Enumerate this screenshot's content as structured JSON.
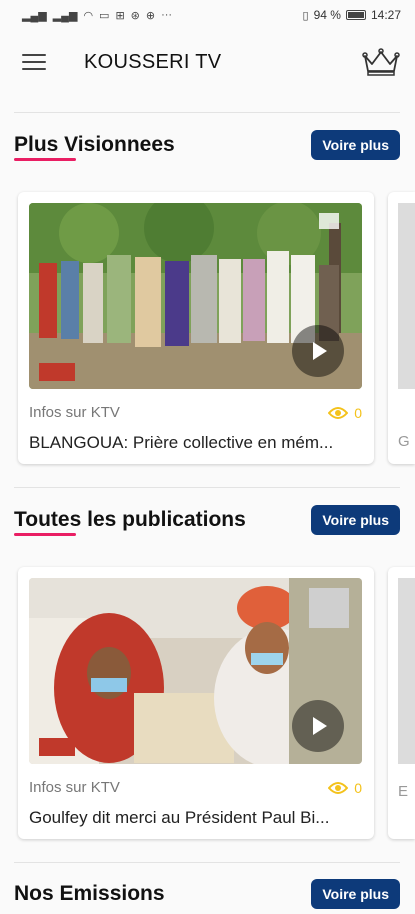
{
  "status_bar": {
    "battery": "94 %",
    "time": "14:27"
  },
  "app_bar": {
    "title": "KOUSSERI TV",
    "menu_icon": "hamburger-icon",
    "crown_icon": "crown-icon"
  },
  "sections": [
    {
      "title": "Plus Visionnees",
      "more_label": "Voire plus",
      "card": {
        "source": "Infos sur KTV",
        "views": "0",
        "caption": "BLANGOUA: Prière collective en mém..."
      },
      "peek_caption": "G"
    },
    {
      "title": "Toutes les publications",
      "more_label": "Voire plus",
      "card": {
        "source": "Infos sur KTV",
        "views": "0",
        "caption": "Goulfey dit merci au Président Paul Bi..."
      },
      "peek_caption": "E"
    },
    {
      "title": "Nos Emissions",
      "more_label": "Voire plus"
    }
  ],
  "colors": {
    "accent": "#0d3a7a",
    "underline": "#e91e63",
    "views": "#f4c21b"
  }
}
